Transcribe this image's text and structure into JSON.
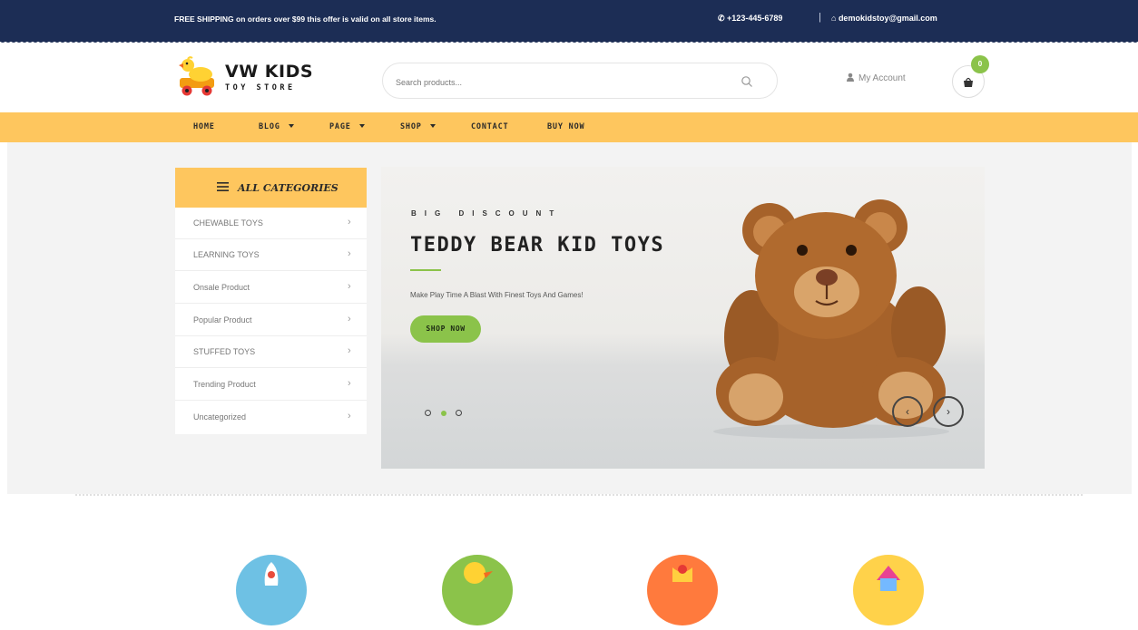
{
  "topbar": {
    "promo": "FREE SHIPPING on orders over $99 this offer is valid on all store items.",
    "phone": "+123-445-6789",
    "separator": "|",
    "email": "demokidstoy@gmail.com"
  },
  "header": {
    "logo_main": "VW KIDS",
    "logo_sub": "TOY STORE",
    "search_placeholder": "Search products...",
    "account_label": "My Account",
    "cart_count": "0"
  },
  "nav": {
    "items": [
      {
        "label": "HOME",
        "has_caret": false
      },
      {
        "label": "BLOG",
        "has_caret": true
      },
      {
        "label": "PAGE",
        "has_caret": true
      },
      {
        "label": "SHOP",
        "has_caret": true
      },
      {
        "label": "CONTACT",
        "has_caret": false
      },
      {
        "label": "BUY NOW",
        "has_caret": false
      }
    ]
  },
  "categories": {
    "title": "ALL CATEGORIES",
    "items": [
      {
        "label": "CHEWABLE TOYS",
        "arrow": "›"
      },
      {
        "label": "LEARNING TOYS",
        "arrow": "›"
      },
      {
        "label": "Onsale Product",
        "arrow": "›"
      },
      {
        "label": "Popular Product",
        "arrow": "›"
      },
      {
        "label": "STUFFED TOYS",
        "arrow": "›"
      },
      {
        "label": "Trending Product",
        "arrow": "›"
      },
      {
        "label": "Uncategorized",
        "arrow": "›"
      }
    ]
  },
  "slider": {
    "subtitle": "BIG DISCOUNT",
    "title": "TEDDY BEAR KID TOYS",
    "text": "Make Play Time A Blast With Finest Toys And Games!",
    "button": "SHOP NOW",
    "active_slide": 2,
    "slide_count": 3,
    "prev_arrow": "‹",
    "next_arrow": "›"
  },
  "features": [
    {
      "icon": "rocket-icon",
      "color": "#6ec1e4"
    },
    {
      "icon": "duck-icon",
      "color": "#8bc34a"
    },
    {
      "icon": "gift-icon",
      "color": "#ff7a3d"
    },
    {
      "icon": "toy-house-icon",
      "color": "#ffd24a"
    }
  ],
  "colors": {
    "topbar": "#1c2d55",
    "accent_yellow": "#fec65e",
    "accent_green": "#8bc34a"
  }
}
